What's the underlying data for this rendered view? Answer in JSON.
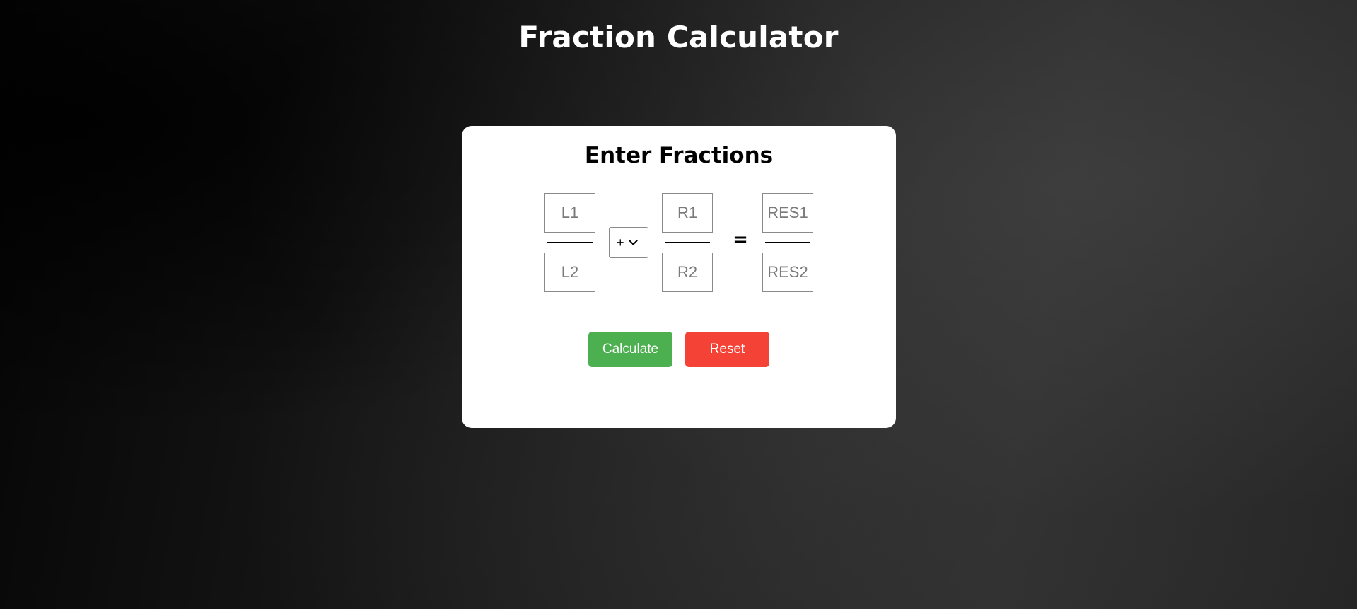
{
  "page": {
    "title": "Fraction Calculator"
  },
  "card": {
    "title": "Enter Fractions",
    "left_fraction": {
      "numerator_placeholder": "L1",
      "denominator_placeholder": "L2"
    },
    "operator": {
      "selected": "+"
    },
    "right_fraction": {
      "numerator_placeholder": "R1",
      "denominator_placeholder": "R2"
    },
    "equals_sign": "=",
    "result_fraction": {
      "numerator_placeholder": "RES1",
      "denominator_placeholder": "RES2"
    },
    "buttons": {
      "calculate_label": "Calculate",
      "reset_label": "Reset"
    }
  },
  "colors": {
    "calculate": "#4caf50",
    "reset": "#f44336"
  },
  "icons": {
    "select_arrow": "chevron-down-icon"
  }
}
